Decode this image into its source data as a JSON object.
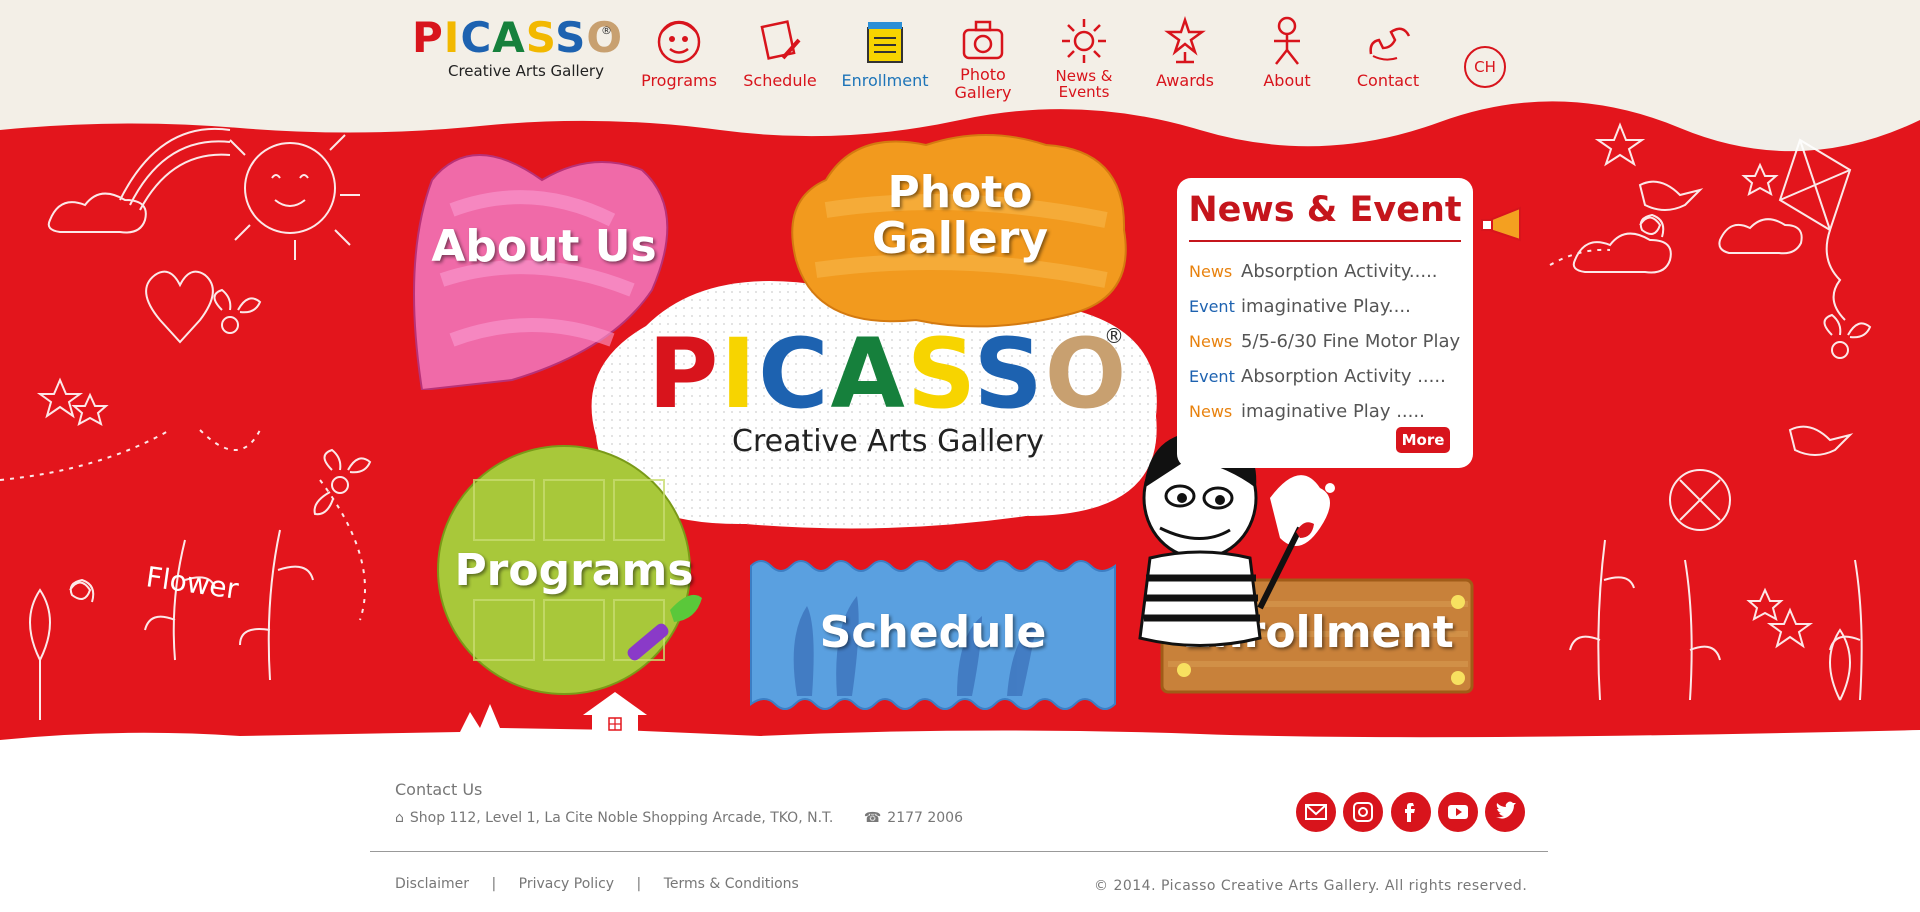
{
  "header": {
    "logo_word": "PICASSO",
    "logo_sub": "Creative Arts Gallery",
    "logo_reg": "®",
    "nav": [
      {
        "label": "Programs",
        "icon": "face-icon"
      },
      {
        "label": "Schedule",
        "icon": "notepad-pen-icon"
      },
      {
        "label": "Enrollment",
        "icon": "gift-list-icon"
      },
      {
        "label": "Photo Gallery",
        "icon": "camera-icon"
      },
      {
        "label": "News & Events",
        "icon": "sun-icon"
      },
      {
        "label": "Awards",
        "icon": "trophy-star-icon"
      },
      {
        "label": "About",
        "icon": "stick-figure-icon"
      },
      {
        "label": "Contact",
        "icon": "telephone-icon"
      }
    ],
    "lang_button": "CH",
    "active_nav": "Enrollment"
  },
  "hero": {
    "tiles": {
      "about": "About Us",
      "photo": "Photo Gallery",
      "programs": "Programs",
      "schedule": "Schedule",
      "enrollment": "Enrollment"
    },
    "center_logo_word": "PICASSO",
    "center_logo_sub": "Creative Arts Gallery",
    "center_logo_reg": "®",
    "doodle_text": "Flower"
  },
  "news": {
    "title": "News & Event",
    "items": [
      {
        "tag": "News",
        "text": "Absorption Activity....."
      },
      {
        "tag": "Event",
        "text": "imaginative Play...."
      },
      {
        "tag": "News",
        "text": "5/5-6/30 Fine Motor Play"
      },
      {
        "tag": "Event",
        "text": "Absorption Activity ....."
      },
      {
        "tag": "News",
        "text": "imaginative Play ....."
      }
    ],
    "more": "More"
  },
  "footer": {
    "contact_title": "Contact Us",
    "address": "Shop 112, Level 1, La Cite Noble Shopping Arcade, TKO, N.T.",
    "phone": "2177 2006",
    "links": [
      "Disclaimer",
      "Privacy Policy",
      "Terms & Conditions"
    ],
    "link_separator": "|",
    "copyright": "© 2014. Picasso Creative Arts Gallery. All rights reserved.",
    "social": [
      "email-icon",
      "instagram-icon",
      "facebook-icon",
      "youtube-icon",
      "twitter-icon"
    ]
  },
  "colors": {
    "brand_red": "#d8141c",
    "header_bg": "#f3efe7",
    "nav_active": "#1d74b8",
    "news_tag": "#e8820e",
    "event_tag": "#1d62b0",
    "logo_letters": [
      "#d8141c",
      "#f2c400",
      "#1d62b0",
      "#16803c",
      "#f2c400",
      "#1d62b0",
      "#c8a070"
    ]
  }
}
